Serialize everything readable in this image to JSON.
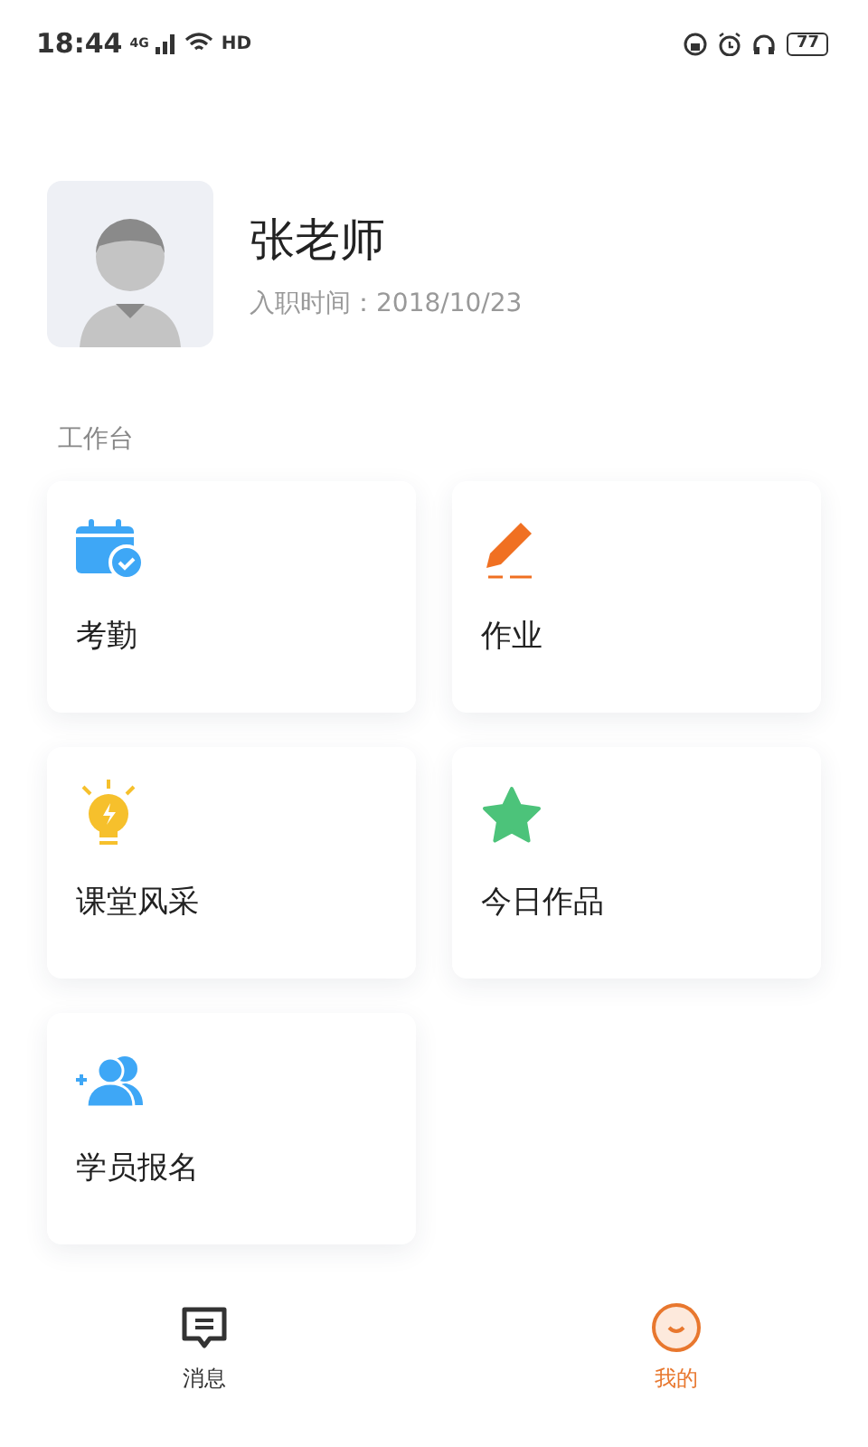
{
  "status_bar": {
    "time": "18:44",
    "network": "4G",
    "hd": "HD",
    "battery": "77"
  },
  "profile": {
    "name": "张老师",
    "hire_date": "入职时间：2018/10/23"
  },
  "section_title": "工作台",
  "tiles": [
    {
      "kind": "calendar",
      "label": "考勤"
    },
    {
      "kind": "pencil",
      "label": "作业"
    },
    {
      "kind": "bulb",
      "label": "课堂风采"
    },
    {
      "kind": "star",
      "label": "今日作品"
    },
    {
      "kind": "user-add",
      "label": "学员报名"
    }
  ],
  "tabs": [
    {
      "kind": "message",
      "label": "消息",
      "selected": false
    },
    {
      "kind": "smile",
      "label": "我的",
      "selected": true
    }
  ]
}
